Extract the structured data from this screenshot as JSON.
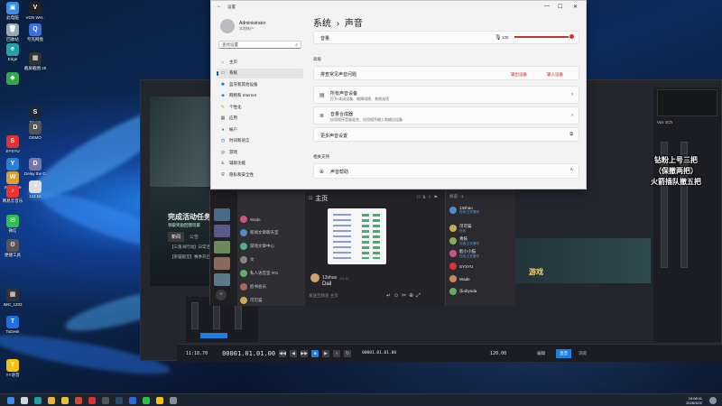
{
  "desktop_icons": [
    {
      "label": "此电脑",
      "color": "#3a8de0",
      "glyph": "▣"
    },
    {
      "label": "回收站",
      "color": "#9aa7b8",
      "glyph": "🗑"
    },
    {
      "label": "Edge",
      "color": "#1fa1a6",
      "glyph": "e"
    },
    {
      "label": "",
      "color": "#2fa84f",
      "glyph": "◆"
    },
    {
      "label": "SYSYU",
      "color": "#d33",
      "glyph": "S"
    },
    {
      "label": "Yishao",
      "color": "#2a7fd4",
      "glyph": "Y"
    },
    {
      "label": "WeGame",
      "color": "#e0a030",
      "glyph": "W"
    },
    {
      "label": "网易云音乐",
      "color": "#e33",
      "glyph": "♪"
    },
    {
      "label": "微信",
      "color": "#2fbf4f",
      "glyph": "✉"
    },
    {
      "label": "便捷工具",
      "color": "#555",
      "glyph": "⚙"
    },
    {
      "label": "IMG_1202",
      "color": "#333",
      "glyph": "▦"
    },
    {
      "label": "ToDesk",
      "color": "#1f6fe0",
      "glyph": "T"
    },
    {
      "label": "YY语音",
      "color": "#f2c20f",
      "glyph": "Y"
    },
    {
      "label": "VGN WH..",
      "color": "#222",
      "glyph": "V"
    },
    {
      "label": "夸克网盘",
      "color": "#3b6fe0",
      "glyph": "Q"
    },
    {
      "label": "截屏截图 2026-03-2..",
      "color": "#333",
      "glyph": "▦"
    },
    {
      "label": "Steam",
      "color": "#1b2838",
      "glyph": "S"
    },
    {
      "label": "DEMO",
      "color": "#555",
      "glyph": "D"
    },
    {
      "label": "Delay the Game 2",
      "color": "#77a",
      "glyph": "D"
    },
    {
      "label": "112.txt",
      "color": "#ddd",
      "glyph": "≡"
    }
  ],
  "settings": {
    "window_title": "设置",
    "user_name": "Administrator",
    "user_sub": "本地帐户",
    "search_placeholder": "查找设置",
    "nav": [
      {
        "label": "主页",
        "icon": "home-icon",
        "color": "#666",
        "glyph": "⌂"
      },
      {
        "label": "系统",
        "icon": "system-icon",
        "color": "#0067c0",
        "glyph": "▭"
      },
      {
        "label": "蓝牙和其他设备",
        "icon": "bluetooth-icon",
        "color": "#0067c0",
        "glyph": "✱"
      },
      {
        "label": "网络和 Internet",
        "icon": "network-icon",
        "color": "#0067c0",
        "glyph": "◈"
      },
      {
        "label": "个性化",
        "icon": "brush-icon",
        "color": "#d27a00",
        "glyph": "✎"
      },
      {
        "label": "应用",
        "icon": "apps-icon",
        "color": "#555",
        "glyph": "▦"
      },
      {
        "label": "帐户",
        "icon": "account-icon",
        "color": "#2e9e5b",
        "glyph": "●"
      },
      {
        "label": "时间和语言",
        "icon": "clock-icon",
        "color": "#0067c0",
        "glyph": "◷"
      },
      {
        "label": "游戏",
        "icon": "game-icon",
        "color": "#555",
        "glyph": "◎"
      },
      {
        "label": "辅助功能",
        "icon": "accessibility-icon",
        "color": "#0067c0",
        "glyph": "♿"
      },
      {
        "label": "隐私和安全性",
        "icon": "shield-icon",
        "color": "#555",
        "glyph": "⛨"
      }
    ],
    "breadcrumb_parent": "系统",
    "breadcrumb_sep": "›",
    "breadcrumb_current": "声音",
    "volume_label": "音量",
    "volume_value": "100",
    "advanced_label": "高级",
    "troubleshoot_label": "排查常见声音问题",
    "troubleshoot_output": "输出设备",
    "troubleshoot_input": "输入设备",
    "all_devices_title": "所有声音设备",
    "all_devices_sub": "打开/关闭设备、故障排除、其他选项",
    "mixer_title": "音量合成器",
    "mixer_sub": "应用程序音量混合、应用程序输入和输出设备",
    "more_settings": "更多声音设置",
    "related_support": "相关支持",
    "sound_help": "声音帮助"
  },
  "daw": {
    "timecode": "00001.01.01.00",
    "time_display": "11:18.70",
    "right_timecode_1": "00001.01.01.00",
    "right_timecode_2": "00001.01.01.00",
    "tempo": "120.00",
    "buttons": [
      "编辑",
      "混音",
      "浏览"
    ],
    "right_track_label": "Vox 1Ch"
  },
  "game": {
    "banner": "完成活动任务",
    "banner_sub": "领取奖励回馈玩家",
    "tabs": [
      "新闻",
      "公告"
    ],
    "news_1": "【三角洲行动】日常活动",
    "news_2": "【荣誉殿堂】赛季开启",
    "right_banner": "游戏"
  },
  "chat": {
    "title": "主页",
    "members_title": "频道 · 1",
    "channels": [
      {
        "label": "Wade",
        "color": "#c58"
      },
      {
        "label": "新闻文章聊天室",
        "color": "#58c"
      },
      {
        "label": "游戏文章中心",
        "color": "#5a8"
      },
      {
        "label": "文",
        "color": "#888"
      },
      {
        "label": "私人语音室 #01",
        "color": "#6a6"
      },
      {
        "label": "脸书会员",
        "color": "#a66"
      },
      {
        "label": "可可猫",
        "color": "#ca5"
      }
    ],
    "message_user": "13shao",
    "message_time": "19:11",
    "message_text": "Dail",
    "input_placeholder": "发送至频道 主页",
    "members": [
      {
        "name": "13shao",
        "sub": "在线·正在聊天",
        "color": "#58c"
      },
      {
        "name": "可可猫",
        "sub": "在线",
        "color": "#ca5"
      },
      {
        "name": "青枝",
        "sub": "在线·正在聊天",
        "color": "#8a5"
      },
      {
        "name": "脸小小猫",
        "sub": "在线·正在聊天",
        "color": "#c58"
      },
      {
        "name": "SYSYU",
        "sub": "",
        "color": "#d33"
      },
      {
        "name": "Wade",
        "sub": "",
        "color": "#c85"
      },
      {
        "name": "乐obyoda",
        "sub": "",
        "color": "#6a6"
      }
    ]
  },
  "overlay_caption": [
    "钻粉上号三把",
    "（保撤两把）",
    "火箭插队撤五把"
  ],
  "tray": {
    "time": "19:08:11",
    "date": "2026/3/22"
  },
  "taskbar_icons": [
    {
      "name": "start-icon",
      "color": "#3b8be8"
    },
    {
      "name": "search-icon",
      "color": "#cfd6df"
    },
    {
      "name": "edge-icon",
      "color": "#1fa1a6"
    },
    {
      "name": "chrome-icon",
      "color": "#e8b33b"
    },
    {
      "name": "folder-icon",
      "color": "#e8c23b"
    },
    {
      "name": "wegame-icon",
      "color": "#d34b2f"
    },
    {
      "name": "netease-icon",
      "color": "#e03030"
    },
    {
      "name": "app-icon",
      "color": "#555"
    },
    {
      "name": "steam-icon",
      "color": "#2a4a6a"
    },
    {
      "name": "daw-icon",
      "color": "#2a6adf"
    },
    {
      "name": "wechat-icon",
      "color": "#2fbf4f"
    },
    {
      "name": "yy-icon",
      "color": "#f2c20f"
    },
    {
      "name": "settings-icon",
      "color": "#8a8f96"
    }
  ]
}
